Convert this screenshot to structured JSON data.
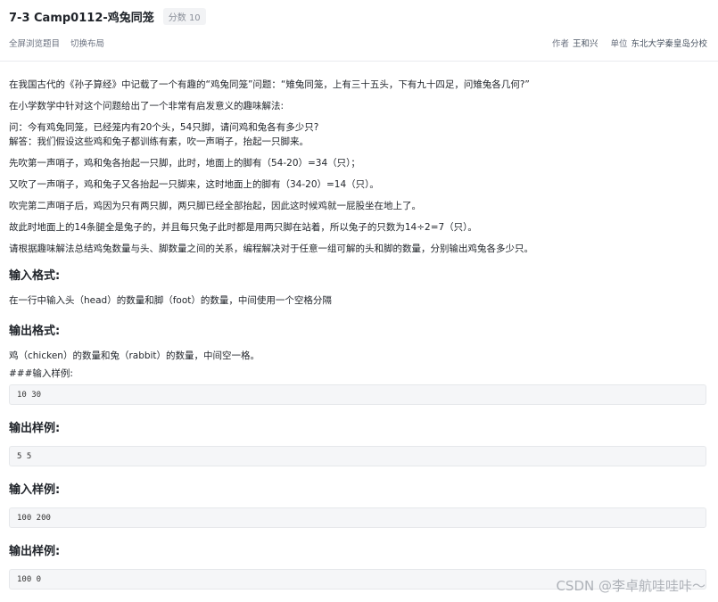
{
  "header": {
    "title": "7-3 Camp0112-鸡兔同笼",
    "score_badge": "分数 10",
    "toolbar": {
      "fullscreen_label": "全屏浏览题目",
      "switch_layout_label": "切换布局"
    },
    "author_label": "作者",
    "author_value": "王和兴",
    "unit_label": "单位",
    "unit_value": "东北大学秦皇岛分校"
  },
  "problem": {
    "p1": "在我国古代的《孙子算经》中记载了一个有趣的“鸡兔同笼”问题：“雉兔同笼，上有三十五头，下有九十四足，问雉兔各几何?”",
    "p2": "在小学数学中针对这个问题给出了一个非常有启发意义的趣味解法:",
    "p3a": "问：今有鸡兔同笼，已经笼内有20个头，54只脚，请问鸡和兔各有多少只?",
    "p3b": "解答：我们假设这些鸡和兔子都训练有素，吹一声哨子，抬起一只脚来。",
    "p4": "先吹第一声哨子，鸡和兔各抬起一只脚，此时，地面上的脚有（54-20）=34（只）；",
    "p5": "又吹了一声哨子，鸡和兔子又各抬起一只脚来，这时地面上的脚有（34-20）=14（只）。",
    "p6": "吹完第二声哨子后，鸡因为只有两只脚，两只脚已经全部抬起，因此这时候鸡就一屁股坐在地上了。",
    "p7": "故此时地面上的14条腿全是兔子的，并且每只兔子此时都是用两只脚在站着，所以兔子的只数为14÷2=7（只）。",
    "p8": "请根据趣味解法总结鸡兔数量与头、脚数量之间的关系，编程解决对于任意一组可解的头和脚的数量，分别输出鸡兔各多少只。"
  },
  "input_format": {
    "heading": "输入格式:",
    "text": "在一行中输入头（head）的数量和脚（foot）的数量，中间使用一个空格分隔"
  },
  "output_format": {
    "heading": "输出格式:",
    "text": "鸡（chicken）的数量和兔（rabbit）的数量，中间空一格。"
  },
  "sample_label": "###输入样例:",
  "samples": {
    "input1": "10 30",
    "output_heading": "输出样例:",
    "output1": "5 5",
    "input_heading": "输入样例:",
    "input2": "100 200",
    "output_heading2": "输出样例:",
    "output2": "100 0"
  },
  "watermark": "CSDN @李卓航哇哇咔～"
}
